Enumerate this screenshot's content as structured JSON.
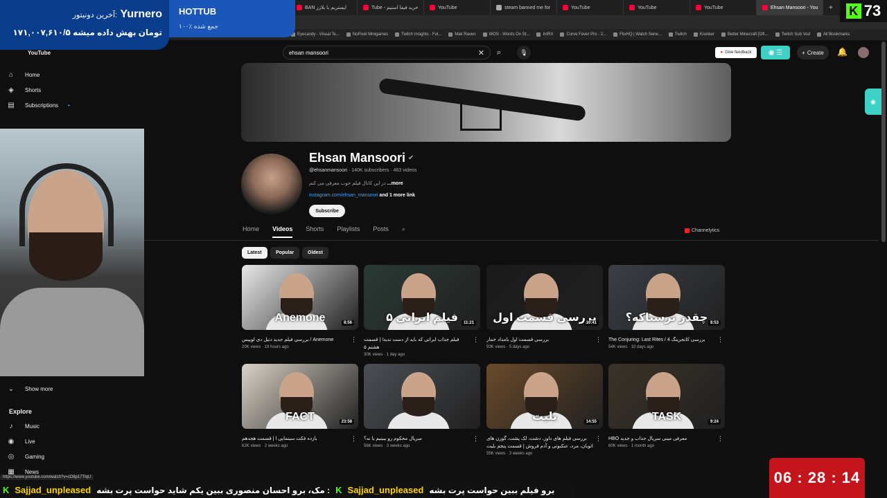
{
  "browser": {
    "tabs": [
      {
        "label": "BAN ایستریم با بلازز"
      },
      {
        "label": "Tube - خرید فیفا استیم"
      },
      {
        "label": "YouTube"
      },
      {
        "label": "steam banned me for"
      },
      {
        "label": "YouTube"
      },
      {
        "label": "YouTube"
      },
      {
        "label": "YouTube"
      },
      {
        "label": "Ehsan Mansoori - You"
      }
    ],
    "bookmarks": [
      "Eyecandy - Visual Te...",
      "NoPixel Minigames",
      "Twitch Insights - Fol...",
      "Mak Raven",
      "WOS - Words On St...",
      "IntRX",
      "Curve Fever Pro - 2...",
      "FlixHQ | Watch Serie...",
      "Twitch",
      "Krunker",
      "Better Minecraft [OfI...",
      "Twitch Sub Vod",
      "All Bookmarks"
    ]
  },
  "overlay": {
    "donor_label": "آخرین دونیتور:",
    "donor_name": "Yurnero",
    "donation_text": "۱۷۱,۰۰۷,۶۱۰/۵ تومان بهش داده میشه",
    "hottub_title": "HOTTUB",
    "hottub_sub": "۱۰۰٪ جمع شده",
    "kick_count": "73",
    "timer": "06 : 28 : 14",
    "chat_user": "Sajjad_unpleased",
    "chat_msg1": "مک، برو احسان منصوری ببین یکم شاید حواست پرت بشه :",
    "chat_user2": "Sajjad_unpleased",
    "chat_msg2": "برو فیلم ببین حواست پرت بشه"
  },
  "status_url": "https://www.youtube.com/watch?v=cD8p17TlqU",
  "sidebar": {
    "logo": "YouTube",
    "items": [
      {
        "label": "Home",
        "icon": "home-icon"
      },
      {
        "label": "Shorts",
        "icon": "shorts-icon"
      },
      {
        "label": "Subscriptions",
        "icon": "subscriptions-icon"
      }
    ],
    "show_more": "Show more",
    "explore_title": "Explore",
    "explore": [
      {
        "label": "Music"
      },
      {
        "label": "Live"
      },
      {
        "label": "Gaming"
      },
      {
        "label": "News"
      }
    ]
  },
  "topbar": {
    "search_value": "ehsan mansoori",
    "feedback": "Give feedback",
    "create": "Create"
  },
  "channel": {
    "name": "Ehsan Mansoori",
    "handle": "@ehsanmansoori",
    "stats": " · 140K subscribers · 463 videos",
    "description": "در این کانال فیلم خوب معرفی می کنم",
    "more": "...more",
    "link": "instagram.com/ehsan_mansoori",
    "more_links": " and 1 more link",
    "subscribe": "Subscribe",
    "tabs": [
      "Home",
      "Videos",
      "Shorts",
      "Playlists",
      "Posts"
    ],
    "active_tab": "Videos",
    "channelytics": "Channelytics"
  },
  "filters": [
    "Latest",
    "Popular",
    "Oldest"
  ],
  "videos": [
    {
      "title": "بررسی فیلم جدید دنیل دی لوییس / Anemone",
      "views": "20K views",
      "age": "19 hours ago",
      "duration": "8:56",
      "overlay": "Anemone",
      "bg": "#e8e8e8"
    },
    {
      "title": "فیلم جذاب ایرانی که باید از دست ندید! | قسمت هشتم ۵",
      "views": "30K views",
      "age": "1 day ago",
      "duration": "11:21",
      "overlay": "۵ فیلم ایرانی",
      "bg": "#2a3a36"
    },
    {
      "title": "بررسی قسمت اول بامداد خمار",
      "views": "93K views",
      "age": "5 days ago",
      "duration": "10:41",
      "overlay": "بررسی قسمت اول",
      "bg": "#1a1a1a"
    },
    {
      "title": "The Conjuring: Last Rites / بررسی کانجرینگ 4",
      "views": "54K views",
      "age": "10 days ago",
      "duration": "8:53",
      "overlay": "چقدر ترسناکه؟",
      "bg": "#3a3f46"
    },
    {
      "title": "بازده فکت سینمایی ا | قسمت هجدهم",
      "views": "62K views",
      "age": "2 weeks ago",
      "duration": "23:58",
      "overlay": "FACT",
      "bg": "#d9d2c6"
    },
    {
      "title": "سریال محکوم رو ببینیم یا نه؟",
      "views": "56K views",
      "age": "3 weeks ago",
      "duration": "",
      "overlay": "",
      "bg": "#4a4f55"
    },
    {
      "title": "بررسی فیلم های داوز، دشت، لک پشت، گوزن های اتوبان، مرد، عنکبوتی و آدم فروش | قسمت پنجم بلیت",
      "views": "55K views",
      "age": "3 weeks ago",
      "duration": "14:55",
      "overlay": "بلیت",
      "bg": "#6a4a2a"
    },
    {
      "title": "HBO معرفی مینی سریال جذاب و جدید",
      "views": "60K views",
      "age": "1 month ago",
      "duration": "9:24",
      "overlay": "TASK",
      "bg": "#3b3328"
    }
  ]
}
